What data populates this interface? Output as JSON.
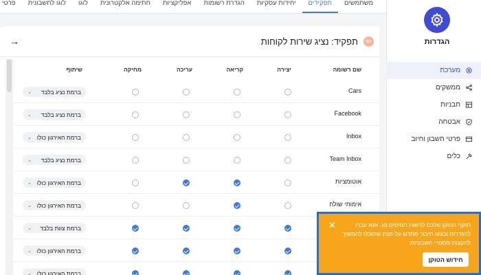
{
  "sidebar": {
    "title": "הגדרות",
    "items": [
      {
        "label": "מערכת",
        "icon": "gear-icon"
      },
      {
        "label": "ממשקים",
        "icon": "share-icon"
      },
      {
        "label": "תבניות",
        "icon": "template-icon"
      },
      {
        "label": "אבטחה",
        "icon": "shield-icon"
      },
      {
        "label": "פרטי חשבון וחיוב",
        "icon": "card-icon"
      },
      {
        "label": "כלים",
        "icon": "tools-icon"
      }
    ]
  },
  "tabs": [
    "משתמשים",
    "תפקידים",
    "יחידות עסקיות",
    "הגדרת רשומות",
    "אפליקציות",
    "חתימה אלקטרונית",
    "לוגו",
    "לוגו לחשבונית",
    "פרטי חברה"
  ],
  "active_tab": "תפקידים",
  "role": {
    "avatar": "נש",
    "title": "תפקיד: נציג שירות לקוחות"
  },
  "table": {
    "headers": {
      "name": "שם רשומה",
      "create": "יצירה",
      "read": "קריאה",
      "edit": "עריכה",
      "delete": "מחיקה",
      "share": "שיתוף"
    },
    "rows": [
      {
        "name": "Cars",
        "create": false,
        "read": false,
        "edit": false,
        "delete": false,
        "share": "ברמת נציג בלבד"
      },
      {
        "name": "Facebook",
        "create": false,
        "read": false,
        "edit": false,
        "delete": false,
        "share": "ברמת נציג בלבד"
      },
      {
        "name": "Inbox",
        "create": false,
        "read": false,
        "edit": false,
        "delete": false,
        "share": "ברמת האירגון כולו"
      },
      {
        "name": "Team Inbox",
        "create": false,
        "read": false,
        "edit": false,
        "delete": false,
        "share": "ברמת נציג בלבד"
      },
      {
        "name": "אוטומציות",
        "create": false,
        "read": true,
        "edit": true,
        "delete": false,
        "share": "ברמת האירגון כולו"
      },
      {
        "name": "אימותי שולח",
        "create": false,
        "read": true,
        "edit": false,
        "delete": false,
        "share": "ברמת האירגון כולו"
      },
      {
        "name": "",
        "create": true,
        "read": true,
        "edit": true,
        "delete": true,
        "share": "ברמת צוות בלבד"
      },
      {
        "name": "",
        "create": true,
        "read": true,
        "edit": true,
        "delete": true,
        "share": "ברמת האירגון כולו"
      },
      {
        "name": "",
        "create": true,
        "read": true,
        "edit": true,
        "delete": true,
        "share": "ברמת האירגון כולו"
      }
    ]
  },
  "toast": {
    "text": "תוקף הטוקן שלכם לרשות המיסים פג. אנא עברו להגדרות ובצעו חיבור מחדש על-מנת שתוכלו להמשיך להקצות מספרי חשבוניות.",
    "button": "חידוש הטוקן",
    "bg_color": "#f7a61b"
  },
  "colors": {
    "accent": "#3f4bd1",
    "checked": "#3f7ad8"
  }
}
